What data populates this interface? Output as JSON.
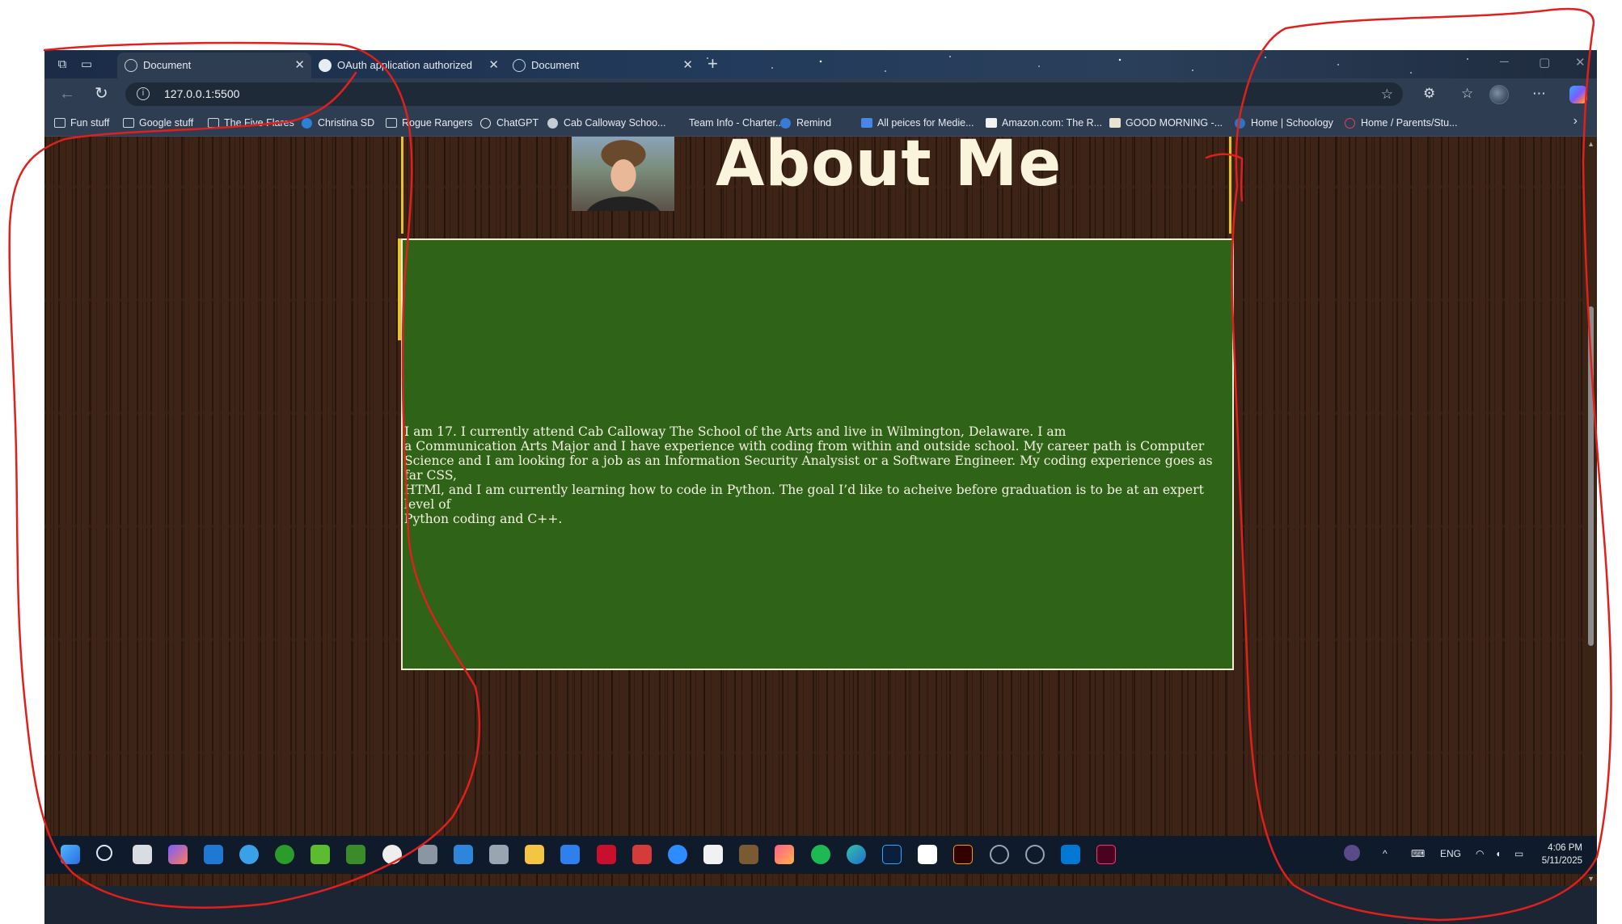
{
  "browser": {
    "tabs": [
      {
        "title": "Document",
        "active": true,
        "icon": "globe-icon"
      },
      {
        "title": "OAuth application authorized",
        "active": false,
        "icon": "github-icon"
      },
      {
        "title": "Document",
        "active": false,
        "icon": "globe-icon"
      }
    ],
    "address_url": "127.0.0.1:5500",
    "bookmarks": [
      {
        "label": "Fun stuff",
        "icon": "folder-icon"
      },
      {
        "label": "Google stuff",
        "icon": "folder-icon"
      },
      {
        "label": "The Five Flares",
        "icon": "folder-icon"
      },
      {
        "label": "Christina SD",
        "icon": "site-icon"
      },
      {
        "label": "Rogue Rangers",
        "icon": "folder-icon"
      },
      {
        "label": "ChatGPT",
        "icon": "chatgpt-icon"
      },
      {
        "label": "Cab Calloway Schoo...",
        "icon": "site-icon"
      },
      {
        "label": "Team Info - Charter...",
        "icon": "site-icon"
      },
      {
        "label": "Remind",
        "icon": "remind-icon"
      },
      {
        "label": "All peices for Medie...",
        "icon": "docs-icon"
      },
      {
        "label": "Amazon.com: The R...",
        "icon": "amazon-icon"
      },
      {
        "label": "GOOD MORNING -...",
        "icon": "site-icon"
      },
      {
        "label": "Home | Schoology",
        "icon": "schoology-icon"
      },
      {
        "label": "Home / Parents/Stu...",
        "icon": "site-icon"
      }
    ]
  },
  "page": {
    "title": "About Me",
    "bio": "I am 17. I currently attend Cab Calloway The School of the Arts and live in Wilmington, Delaware. I am\na Communication Arts Major and I have experience with coding from within and outside school. My career path is Computer\nScience and I am looking for a job as an Information Security Analysist or a Software Engineer. My coding experience goes as far CSS,\nHTMl, and I am currently learning how to code in Python. The goal I’d like to acheive before graduation is to be at an expert level of\nPython coding and C++.",
    "colors": {
      "content_bg": "#2e6318",
      "wood_bg": "#3d2416",
      "accent_border": "#e8c22a",
      "title_color": "#fbf4dd"
    }
  },
  "taskbar": {
    "language": "ENG",
    "time": "4:06 PM",
    "date": "5/11/2025"
  },
  "annotations": {
    "color": "#e0201c",
    "description": "three hand-drawn red outlines"
  }
}
